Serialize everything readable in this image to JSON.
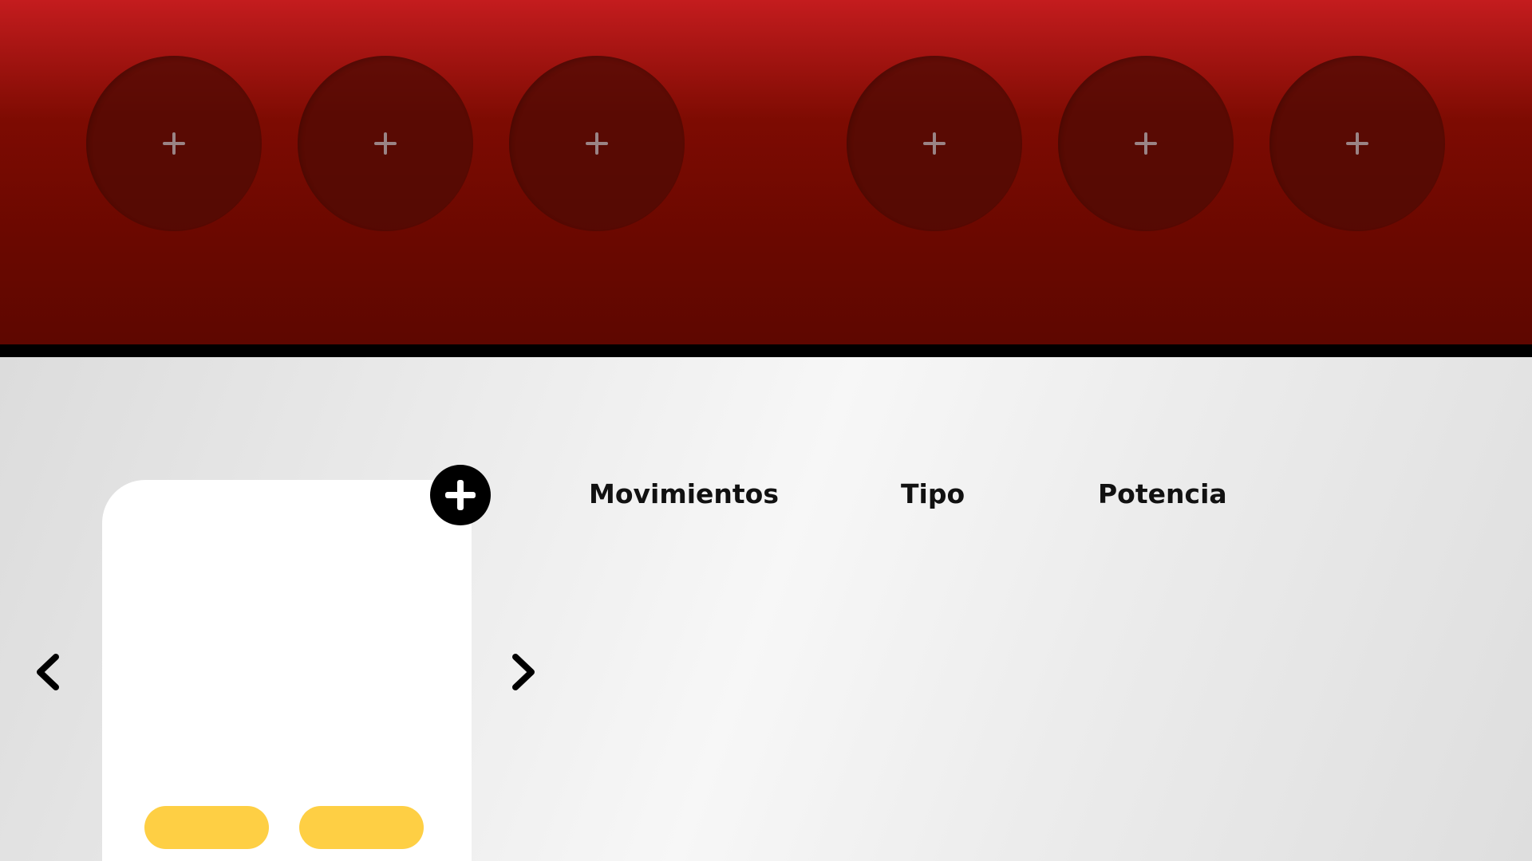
{
  "team": {
    "slots": [
      {
        "icon": "plus-icon"
      },
      {
        "icon": "plus-icon"
      },
      {
        "icon": "plus-icon"
      },
      {
        "icon": "plus-icon"
      },
      {
        "icon": "plus-icon"
      },
      {
        "icon": "plus-icon"
      }
    ],
    "colors": {
      "panel_top": "#c41c1e",
      "panel_bottom": "#5e0700",
      "slot_fill": "#500a04",
      "plus_color": "#9a8486"
    }
  },
  "card": {
    "add_icon": "plus-circle-icon",
    "prev_icon": "chevron-left-icon",
    "next_icon": "chevron-right-icon",
    "pill_color": "#fecf44"
  },
  "moves_table": {
    "headers": [
      "Movimientos",
      "Tipo",
      "Potencia"
    ]
  }
}
